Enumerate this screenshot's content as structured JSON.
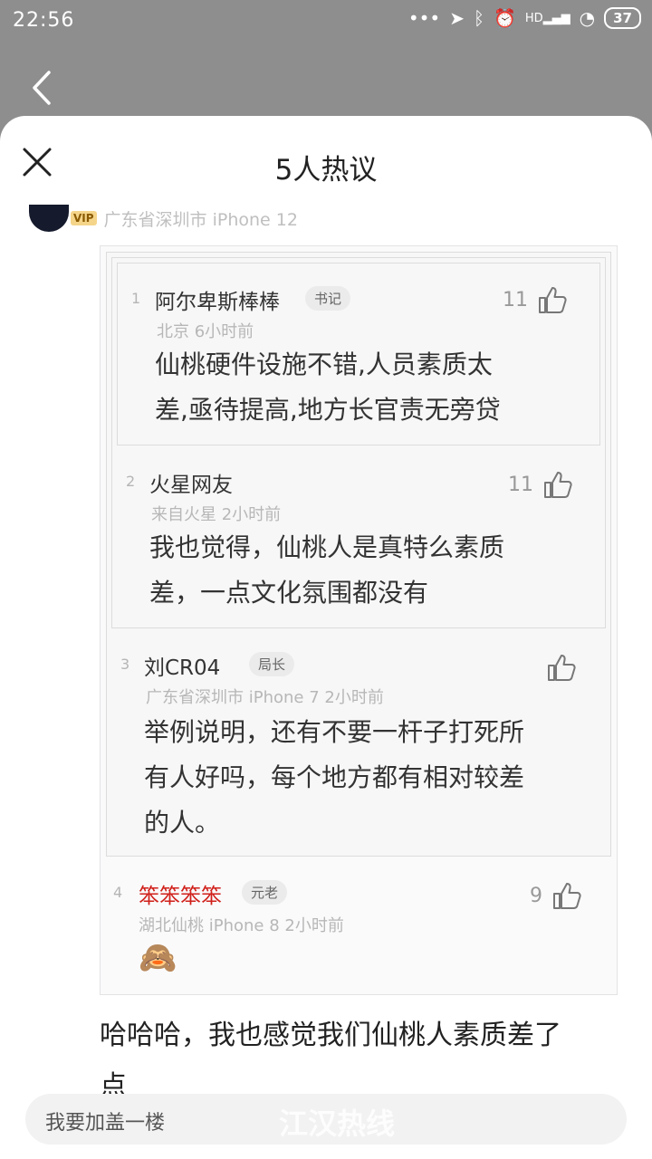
{
  "status_bar": {
    "time": "22:56",
    "signal_label": "HD",
    "battery": "37"
  },
  "sheet": {
    "title": "5人热议"
  },
  "original_post": {
    "meta": "广东省深圳市  iPhone 12",
    "vip_label": "VIP"
  },
  "quotes": [
    {
      "num": "1",
      "name": "阿尔卑斯棒棒",
      "badge": "书记",
      "meta": "北京  6小时前",
      "likes": "11",
      "text_lines": [
        "仙桃硬件设施不错,人员素质太",
        "差,亟待提高,地方长官责无旁贷"
      ]
    },
    {
      "num": "2",
      "name": "火星网友",
      "badge": "",
      "meta": "来自火星  2小时前",
      "likes": "11",
      "text_lines": [
        "我也觉得，仙桃人是真特么素质",
        "差，一点文化氛围都没有"
      ]
    },
    {
      "num": "3",
      "name": "刘CR04",
      "badge": "局长",
      "meta": "广东省深圳市  iPhone 7  2小时前",
      "likes": "",
      "text_lines": [
        "举例说明，还有不要一杆子打死所",
        "有人好吗，每个地方都有相对较差",
        "的人。"
      ]
    },
    {
      "num": "4",
      "name": "笨笨笨笨",
      "badge": "元老",
      "meta": "湖北仙桃  iPhone 8  2小时前",
      "likes": "9",
      "emoji": "🙈"
    }
  ],
  "reply": {
    "text_line1": "哈哈哈，我也感觉我们仙桃人素质差了",
    "text_line2": "点"
  },
  "input_bar": {
    "placeholder": "我要加盖一楼",
    "watermark": "江汉热线"
  }
}
